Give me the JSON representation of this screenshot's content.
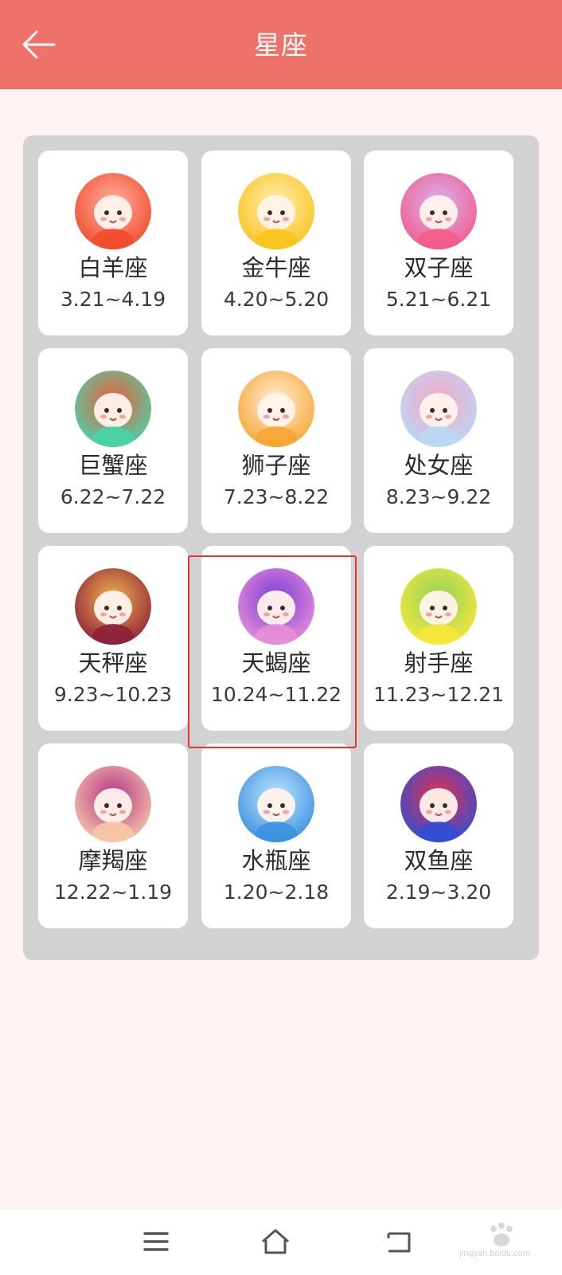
{
  "header": {
    "title": "星座"
  },
  "signs": [
    {
      "name": "白羊座",
      "range": "3.21~4.19",
      "icon": "aries-avatar-icon",
      "colors": [
        "#f04a2a",
        "#ffb0a0"
      ]
    },
    {
      "name": "金牛座",
      "range": "4.20~5.20",
      "icon": "taurus-avatar-icon",
      "colors": [
        "#f9c21c",
        "#fff1b0"
      ]
    },
    {
      "name": "双子座",
      "range": "5.21~6.21",
      "icon": "gemini-avatar-icon",
      "colors": [
        "#f25b88",
        "#d9b2f5"
      ]
    },
    {
      "name": "巨蟹座",
      "range": "6.22~7.22",
      "icon": "cancer-avatar-icon",
      "colors": [
        "#43d6a8",
        "#f25a3c"
      ]
    },
    {
      "name": "狮子座",
      "range": "7.23~8.22",
      "icon": "leo-avatar-icon",
      "colors": [
        "#f7a431",
        "#fff0d8"
      ]
    },
    {
      "name": "处女座",
      "range": "8.23~9.22",
      "icon": "virgo-avatar-icon",
      "colors": [
        "#b9d9f5",
        "#f6a5c6"
      ]
    },
    {
      "name": "天秤座",
      "range": "9.23~10.23",
      "icon": "libra-avatar-icon",
      "colors": [
        "#8c1d3b",
        "#f3b54b"
      ]
    },
    {
      "name": "天蝎座",
      "range": "10.24~11.22",
      "icon": "scorpio-avatar-icon",
      "colors": [
        "#e98ed8",
        "#7b3fd8"
      ]
    },
    {
      "name": "射手座",
      "range": "11.23~12.21",
      "icon": "sagittarius-avatar-icon",
      "colors": [
        "#f7e83a",
        "#8fd35c"
      ]
    },
    {
      "name": "摩羯座",
      "range": "12.22~1.19",
      "icon": "capricorn-avatar-icon",
      "colors": [
        "#f8c9a8",
        "#b4328a"
      ]
    },
    {
      "name": "水瓶座",
      "range": "1.20~2.18",
      "icon": "aquarius-avatar-icon",
      "colors": [
        "#3a8fe0",
        "#bfe6ff"
      ]
    },
    {
      "name": "双鱼座",
      "range": "2.19~3.20",
      "icon": "pisces-avatar-icon",
      "colors": [
        "#2f4fd6",
        "#e6304a"
      ]
    }
  ],
  "selected_index": 7,
  "watermark": {
    "brand": "Baidu 经验",
    "url": "jingyan.baidu.com"
  },
  "colors": {
    "header": "#ef7268",
    "background": "#fdf3f3",
    "highlight": "#e8332f"
  }
}
